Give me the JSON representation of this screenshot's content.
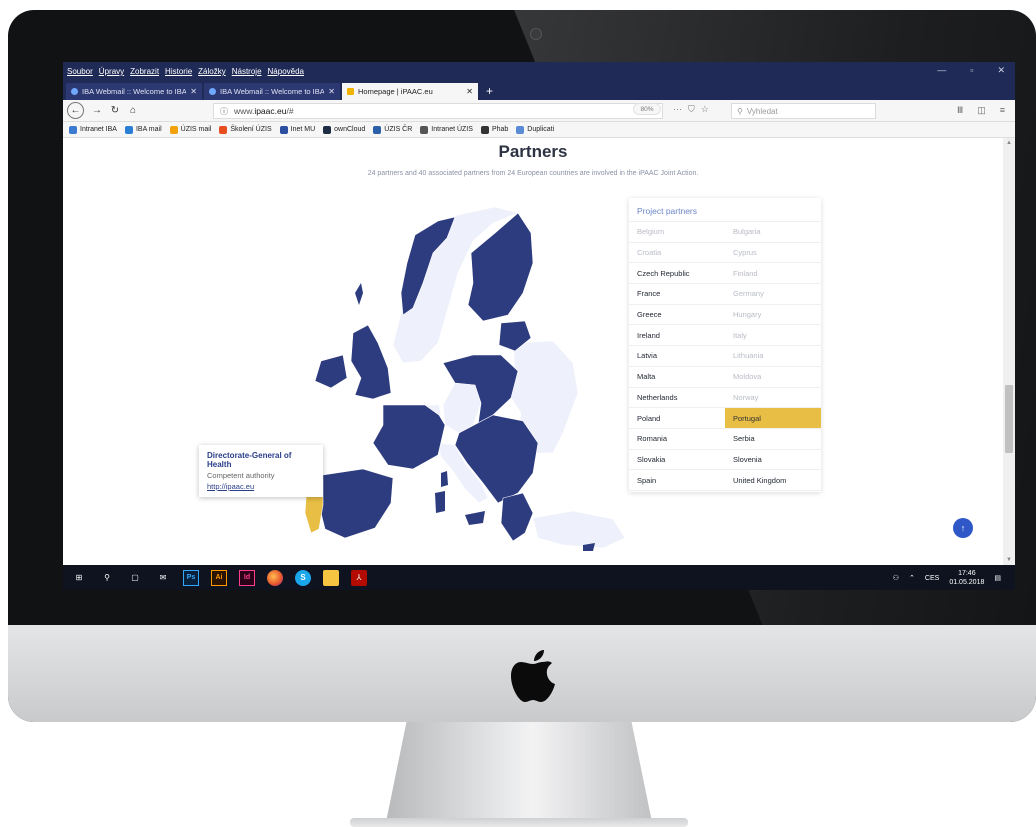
{
  "browser": {
    "menu": [
      "Soubor",
      "Úpravy",
      "Zobrazit",
      "Historie",
      "Záložky",
      "Nástroje",
      "Nápověda"
    ],
    "tabs": [
      {
        "label": "IBA Webmail :: Welcome to IBA"
      },
      {
        "label": "IBA Webmail :: Welcome to IBA"
      },
      {
        "label": "Homepage | iPAAC.eu"
      }
    ],
    "url": {
      "prefix": "www.",
      "domain": "ipaac.eu",
      "suffix": "/#"
    },
    "zoom": "80%",
    "search_placeholder": "Vyhledat",
    "bookmarks": [
      {
        "label": "Intranet IBA",
        "color": "#3b7ad0"
      },
      {
        "label": "IBA mail",
        "color": "#2a7fd4"
      },
      {
        "label": "ÚZIS mail",
        "color": "#f1a20c"
      },
      {
        "label": "Školení ÚZIS",
        "color": "#e84d1f"
      },
      {
        "label": "Inet MU",
        "color": "#2c4ea0"
      },
      {
        "label": "ownCloud",
        "color": "#1d2d44"
      },
      {
        "label": "ÚZIS ČR",
        "color": "#2b5fa8"
      },
      {
        "label": "Intranet ÚZIS",
        "color": "#555555"
      },
      {
        "label": "Phab",
        "color": "#333333"
      },
      {
        "label": "Duplicati",
        "color": "#5a8bd6"
      }
    ]
  },
  "page": {
    "heading": "Partners",
    "subtitle": "24 partners and 40 associated partners from 24 European countries are involved in the iPAAC Joint Action.",
    "tooltip": {
      "name": "Directorate-General of Health",
      "role": "Competent authority",
      "link": "http://ipaac.eu"
    },
    "partners_title": "Project partners",
    "partners_rows": [
      [
        {
          "name": "Belgium",
          "state": "off"
        },
        {
          "name": "Bulgaria",
          "state": "off"
        }
      ],
      [
        {
          "name": "Croatia",
          "state": "off"
        },
        {
          "name": "Cyprus",
          "state": "off"
        }
      ],
      [
        {
          "name": "Czech Republic",
          "state": "on"
        },
        {
          "name": "Finland",
          "state": "off"
        }
      ],
      [
        {
          "name": "France",
          "state": "on"
        },
        {
          "name": "Germany",
          "state": "off"
        }
      ],
      [
        {
          "name": "Greece",
          "state": "on"
        },
        {
          "name": "Hungary",
          "state": "off"
        }
      ],
      [
        {
          "name": "Ireland",
          "state": "on"
        },
        {
          "name": "Italy",
          "state": "off"
        }
      ],
      [
        {
          "name": "Latvia",
          "state": "on"
        },
        {
          "name": "Lithuania",
          "state": "off"
        }
      ],
      [
        {
          "name": "Malta",
          "state": "on"
        },
        {
          "name": "Moldova",
          "state": "off"
        }
      ],
      [
        {
          "name": "Netherlands",
          "state": "on"
        },
        {
          "name": "Norway",
          "state": "off"
        }
      ],
      [
        {
          "name": "Poland",
          "state": "on"
        },
        {
          "name": "Portugal",
          "state": "sel"
        }
      ],
      [
        {
          "name": "Romania",
          "state": "on"
        },
        {
          "name": "Serbia",
          "state": "on"
        }
      ],
      [
        {
          "name": "Slovakia",
          "state": "on"
        },
        {
          "name": "Slovenia",
          "state": "on"
        }
      ],
      [
        {
          "name": "Spain",
          "state": "on"
        },
        {
          "name": "United Kingdom",
          "state": "on"
        }
      ]
    ],
    "colors": {
      "partner": "#2d3c7f",
      "other": "#eef0fb",
      "selected": "#e8be45",
      "accent": "#2f57c8"
    }
  },
  "taskbar": {
    "apps": [
      {
        "name": "windows-icon",
        "glyph": "⊞"
      },
      {
        "name": "search-icon",
        "glyph": "⚲"
      },
      {
        "name": "task-view-icon",
        "glyph": "▢"
      },
      {
        "name": "mail-icon",
        "glyph": "✉"
      },
      {
        "name": "photoshop-icon",
        "glyph": "Ps"
      },
      {
        "name": "illustrator-icon",
        "glyph": "Ai"
      },
      {
        "name": "indesign-icon",
        "glyph": "Id"
      },
      {
        "name": "firefox-icon",
        "glyph": ""
      },
      {
        "name": "skype-icon",
        "glyph": "S"
      },
      {
        "name": "file-explorer-icon",
        "glyph": ""
      },
      {
        "name": "acrobat-icon",
        "glyph": "⅄"
      }
    ],
    "lang": "CES",
    "time": "17:46",
    "date": "01.05.2018"
  }
}
